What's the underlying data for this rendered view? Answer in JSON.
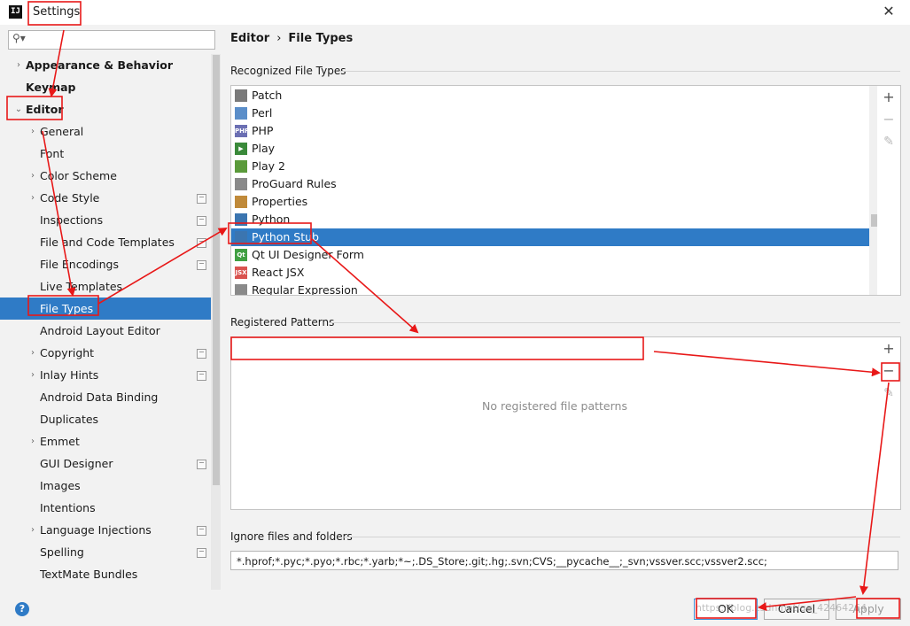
{
  "window": {
    "title": "Settings",
    "app_icon_text": "IJ"
  },
  "search": {
    "placeholder": ""
  },
  "sidebar": {
    "items": [
      {
        "label": "Appearance & Behavior",
        "level": 0,
        "expandable": true,
        "bold": true
      },
      {
        "label": "Keymap",
        "level": 0,
        "expandable": false,
        "bold": true
      },
      {
        "label": "Editor",
        "level": 0,
        "expandable": true,
        "expanded": true,
        "bold": true
      },
      {
        "label": "General",
        "level": 1,
        "expandable": true
      },
      {
        "label": "Font",
        "level": 1
      },
      {
        "label": "Color Scheme",
        "level": 1,
        "expandable": true
      },
      {
        "label": "Code Style",
        "level": 1,
        "expandable": true,
        "project": true
      },
      {
        "label": "Inspections",
        "level": 1,
        "project": true
      },
      {
        "label": "File and Code Templates",
        "level": 1,
        "project": true
      },
      {
        "label": "File Encodings",
        "level": 1,
        "project": true
      },
      {
        "label": "Live Templates",
        "level": 1
      },
      {
        "label": "File Types",
        "level": 1,
        "selected": true
      },
      {
        "label": "Android Layout Editor",
        "level": 1
      },
      {
        "label": "Copyright",
        "level": 1,
        "expandable": true,
        "project": true
      },
      {
        "label": "Inlay Hints",
        "level": 1,
        "expandable": true,
        "project": true
      },
      {
        "label": "Android Data Binding",
        "level": 1
      },
      {
        "label": "Duplicates",
        "level": 1
      },
      {
        "label": "Emmet",
        "level": 1,
        "expandable": true
      },
      {
        "label": "GUI Designer",
        "level": 1,
        "project": true
      },
      {
        "label": "Images",
        "level": 1
      },
      {
        "label": "Intentions",
        "level": 1
      },
      {
        "label": "Language Injections",
        "level": 1,
        "expandable": true,
        "project": true
      },
      {
        "label": "Spelling",
        "level": 1,
        "project": true
      },
      {
        "label": "TextMate Bundles",
        "level": 1
      }
    ]
  },
  "breadcrumb": {
    "parent": "Editor",
    "separator": "›",
    "current": "File Types"
  },
  "recognized": {
    "title": "Recognized File Types",
    "items": [
      {
        "label": "Patch",
        "icon": "patch-file-icon",
        "color": "#7a7a7a",
        "glyph": ""
      },
      {
        "label": "Perl",
        "icon": "perl-file-icon",
        "color": "#5b8ec9",
        "glyph": ""
      },
      {
        "label": "PHP",
        "icon": "php-file-icon",
        "color": "#6b6fb3",
        "glyph": "PHP"
      },
      {
        "label": "Play",
        "icon": "play-file-icon",
        "color": "#3a8a3a",
        "glyph": "▶"
      },
      {
        "label": "Play 2",
        "icon": "play2-file-icon",
        "color": "#5a9a3a",
        "glyph": ""
      },
      {
        "label": "ProGuard Rules",
        "icon": "proguard-file-icon",
        "color": "#8a8a8a",
        "glyph": ""
      },
      {
        "label": "Properties",
        "icon": "properties-file-icon",
        "color": "#c08a3a",
        "glyph": ""
      },
      {
        "label": "Python",
        "icon": "python-file-icon",
        "color": "#3b75b0",
        "glyph": ""
      },
      {
        "label": "Python Stub",
        "icon": "python-stub-file-icon",
        "color": "#3b75b0",
        "glyph": "",
        "selected": true
      },
      {
        "label": "Qt UI Designer Form",
        "icon": "qt-file-icon",
        "color": "#41a043",
        "glyph": "Qt"
      },
      {
        "label": "React JSX",
        "icon": "jsx-file-icon",
        "color": "#d9534f",
        "glyph": "JSX"
      },
      {
        "label": "Regular Expression",
        "icon": "regex-file-icon",
        "color": "#8a8a8a",
        "glyph": ""
      }
    ]
  },
  "patterns": {
    "title": "Registered Patterns",
    "empty": "No registered file patterns"
  },
  "ignore": {
    "title": "Ignore files and folders",
    "value": "*.hprof;*.pyc;*.pyo;*.rbc;*.yarb;*~;.DS_Store;.git;.hg;.svn;CVS;__pycache__;_svn;vssver.scc;vssver2.scc;"
  },
  "tools": {
    "add": "+",
    "remove": "−",
    "edit": "✎"
  },
  "footer": {
    "help": "?",
    "ok": "OK",
    "cancel": "Cancel",
    "apply": "Apply",
    "watermark": "https://blog.csdn.net/qq_42464264"
  },
  "colors": {
    "accent": "#2f7bc6",
    "annotation": "#e81818"
  }
}
